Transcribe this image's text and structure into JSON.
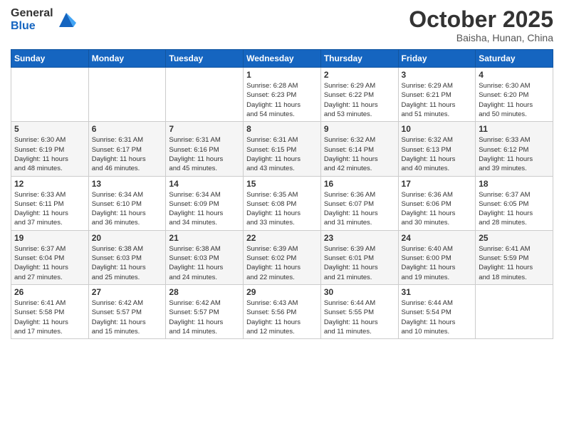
{
  "header": {
    "logo_general": "General",
    "logo_blue": "Blue",
    "month": "October 2025",
    "location": "Baisha, Hunan, China"
  },
  "weekdays": [
    "Sunday",
    "Monday",
    "Tuesday",
    "Wednesday",
    "Thursday",
    "Friday",
    "Saturday"
  ],
  "weeks": [
    [
      {
        "day": "",
        "info": ""
      },
      {
        "day": "",
        "info": ""
      },
      {
        "day": "",
        "info": ""
      },
      {
        "day": "1",
        "info": "Sunrise: 6:28 AM\nSunset: 6:23 PM\nDaylight: 11 hours\nand 54 minutes."
      },
      {
        "day": "2",
        "info": "Sunrise: 6:29 AM\nSunset: 6:22 PM\nDaylight: 11 hours\nand 53 minutes."
      },
      {
        "day": "3",
        "info": "Sunrise: 6:29 AM\nSunset: 6:21 PM\nDaylight: 11 hours\nand 51 minutes."
      },
      {
        "day": "4",
        "info": "Sunrise: 6:30 AM\nSunset: 6:20 PM\nDaylight: 11 hours\nand 50 minutes."
      }
    ],
    [
      {
        "day": "5",
        "info": "Sunrise: 6:30 AM\nSunset: 6:19 PM\nDaylight: 11 hours\nand 48 minutes."
      },
      {
        "day": "6",
        "info": "Sunrise: 6:31 AM\nSunset: 6:17 PM\nDaylight: 11 hours\nand 46 minutes."
      },
      {
        "day": "7",
        "info": "Sunrise: 6:31 AM\nSunset: 6:16 PM\nDaylight: 11 hours\nand 45 minutes."
      },
      {
        "day": "8",
        "info": "Sunrise: 6:31 AM\nSunset: 6:15 PM\nDaylight: 11 hours\nand 43 minutes."
      },
      {
        "day": "9",
        "info": "Sunrise: 6:32 AM\nSunset: 6:14 PM\nDaylight: 11 hours\nand 42 minutes."
      },
      {
        "day": "10",
        "info": "Sunrise: 6:32 AM\nSunset: 6:13 PM\nDaylight: 11 hours\nand 40 minutes."
      },
      {
        "day": "11",
        "info": "Sunrise: 6:33 AM\nSunset: 6:12 PM\nDaylight: 11 hours\nand 39 minutes."
      }
    ],
    [
      {
        "day": "12",
        "info": "Sunrise: 6:33 AM\nSunset: 6:11 PM\nDaylight: 11 hours\nand 37 minutes."
      },
      {
        "day": "13",
        "info": "Sunrise: 6:34 AM\nSunset: 6:10 PM\nDaylight: 11 hours\nand 36 minutes."
      },
      {
        "day": "14",
        "info": "Sunrise: 6:34 AM\nSunset: 6:09 PM\nDaylight: 11 hours\nand 34 minutes."
      },
      {
        "day": "15",
        "info": "Sunrise: 6:35 AM\nSunset: 6:08 PM\nDaylight: 11 hours\nand 33 minutes."
      },
      {
        "day": "16",
        "info": "Sunrise: 6:36 AM\nSunset: 6:07 PM\nDaylight: 11 hours\nand 31 minutes."
      },
      {
        "day": "17",
        "info": "Sunrise: 6:36 AM\nSunset: 6:06 PM\nDaylight: 11 hours\nand 30 minutes."
      },
      {
        "day": "18",
        "info": "Sunrise: 6:37 AM\nSunset: 6:05 PM\nDaylight: 11 hours\nand 28 minutes."
      }
    ],
    [
      {
        "day": "19",
        "info": "Sunrise: 6:37 AM\nSunset: 6:04 PM\nDaylight: 11 hours\nand 27 minutes."
      },
      {
        "day": "20",
        "info": "Sunrise: 6:38 AM\nSunset: 6:03 PM\nDaylight: 11 hours\nand 25 minutes."
      },
      {
        "day": "21",
        "info": "Sunrise: 6:38 AM\nSunset: 6:03 PM\nDaylight: 11 hours\nand 24 minutes."
      },
      {
        "day": "22",
        "info": "Sunrise: 6:39 AM\nSunset: 6:02 PM\nDaylight: 11 hours\nand 22 minutes."
      },
      {
        "day": "23",
        "info": "Sunrise: 6:39 AM\nSunset: 6:01 PM\nDaylight: 11 hours\nand 21 minutes."
      },
      {
        "day": "24",
        "info": "Sunrise: 6:40 AM\nSunset: 6:00 PM\nDaylight: 11 hours\nand 19 minutes."
      },
      {
        "day": "25",
        "info": "Sunrise: 6:41 AM\nSunset: 5:59 PM\nDaylight: 11 hours\nand 18 minutes."
      }
    ],
    [
      {
        "day": "26",
        "info": "Sunrise: 6:41 AM\nSunset: 5:58 PM\nDaylight: 11 hours\nand 17 minutes."
      },
      {
        "day": "27",
        "info": "Sunrise: 6:42 AM\nSunset: 5:57 PM\nDaylight: 11 hours\nand 15 minutes."
      },
      {
        "day": "28",
        "info": "Sunrise: 6:42 AM\nSunset: 5:57 PM\nDaylight: 11 hours\nand 14 minutes."
      },
      {
        "day": "29",
        "info": "Sunrise: 6:43 AM\nSunset: 5:56 PM\nDaylight: 11 hours\nand 12 minutes."
      },
      {
        "day": "30",
        "info": "Sunrise: 6:44 AM\nSunset: 5:55 PM\nDaylight: 11 hours\nand 11 minutes."
      },
      {
        "day": "31",
        "info": "Sunrise: 6:44 AM\nSunset: 5:54 PM\nDaylight: 11 hours\nand 10 minutes."
      },
      {
        "day": "",
        "info": ""
      }
    ]
  ]
}
